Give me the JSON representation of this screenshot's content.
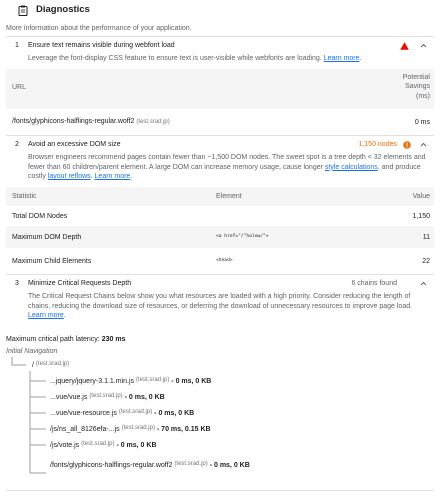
{
  "section": {
    "title": "Diagnostics",
    "description": "More information about the performance of your application."
  },
  "audits": [
    {
      "number": "1",
      "title": "Ensure text remains visible during webfont load",
      "status_color": "#eb0f00",
      "description_prefix": "Leverage the font-display CSS feature to ensure text is user-visible while webfonts are loading. ",
      "learn_more": "Learn more",
      "table": {
        "header_url": "URL",
        "header_savings_1": "Potential",
        "header_savings_2": "Savings",
        "header_savings_3": "(ms)",
        "rows": [
          {
            "url": "/fonts/glyphicons-halflings-regular.woff2",
            "host": "(test.srad.jp)",
            "value": "0 ms"
          }
        ]
      }
    },
    {
      "number": "2",
      "title": "Avoid an excessive DOM size",
      "value": "1,150 nodes",
      "status_color": "#e8710a",
      "description_part1": "Browser engineers recommend pages contain fewer than ~1,500 DOM nodes. The sweet spot is a tree depth < 32 elements and fewer than 60 children/parent element. A large DOM can increase memory usage, cause longer ",
      "link1": "style calculations",
      "description_part2": ", and produce costly ",
      "link2": "layout reflows",
      "description_part3": ". ",
      "learn_more": "Learn more",
      "table": {
        "headers": [
          "Statistic",
          "Element",
          "Value"
        ],
        "rows": [
          {
            "statistic": "Total DOM Nodes",
            "element": "",
            "value": "1,150"
          },
          {
            "statistic": "Maximum DOM Depth",
            "element": "<a href=\"/\"holow/\">",
            "value": "11"
          },
          {
            "statistic": "Maximum Child Elements",
            "element": "<head>",
            "value": "22"
          }
        ]
      }
    },
    {
      "number": "3",
      "title": "Minimize Critical Requests Depth",
      "value": "6 chains found",
      "description_prefix": "The Critical Request Chains below show you what resources are loaded with a high priority. Consider reducing the length of chains, reducing the download size of resources, or deferring the download of unnecessary resources to improve page load. ",
      "learn_more": "Learn more",
      "latency_label": "Maximum critical path latency:",
      "latency_value": "230 ms",
      "initial_navigation": "Initial Navigation",
      "root": {
        "path": "/",
        "host": "(test.srad.jp)"
      },
      "chains": [
        {
          "path": "...jquery/jquery-3.1.1.min.js",
          "host": "(test.srad.jp)",
          "stats": "- 0 ms, 0 KB"
        },
        {
          "path": "...vue/vue.js",
          "host": "(test.srad.jp)",
          "stats": "- 0 ms, 0 KB"
        },
        {
          "path": "...vue/vue-resource.js",
          "host": "(test.srad.jp)",
          "stats": "- 0 ms, 0 KB"
        },
        {
          "path": "/js/ns_all_8126efa-...js",
          "host": "(test.srad.jp)",
          "stats": "- 70 ms, 0.15 KB"
        },
        {
          "path": "/js/vote.js",
          "host": "(test.srad.jp)",
          "stats": "- 0 ms, 0 KB"
        },
        {
          "path": "/fonts/glyphicons-halflings-regular.woff2",
          "host": "(test.srad.jp)",
          "stats": "- 0 ms, 0 KB"
        }
      ]
    }
  ]
}
